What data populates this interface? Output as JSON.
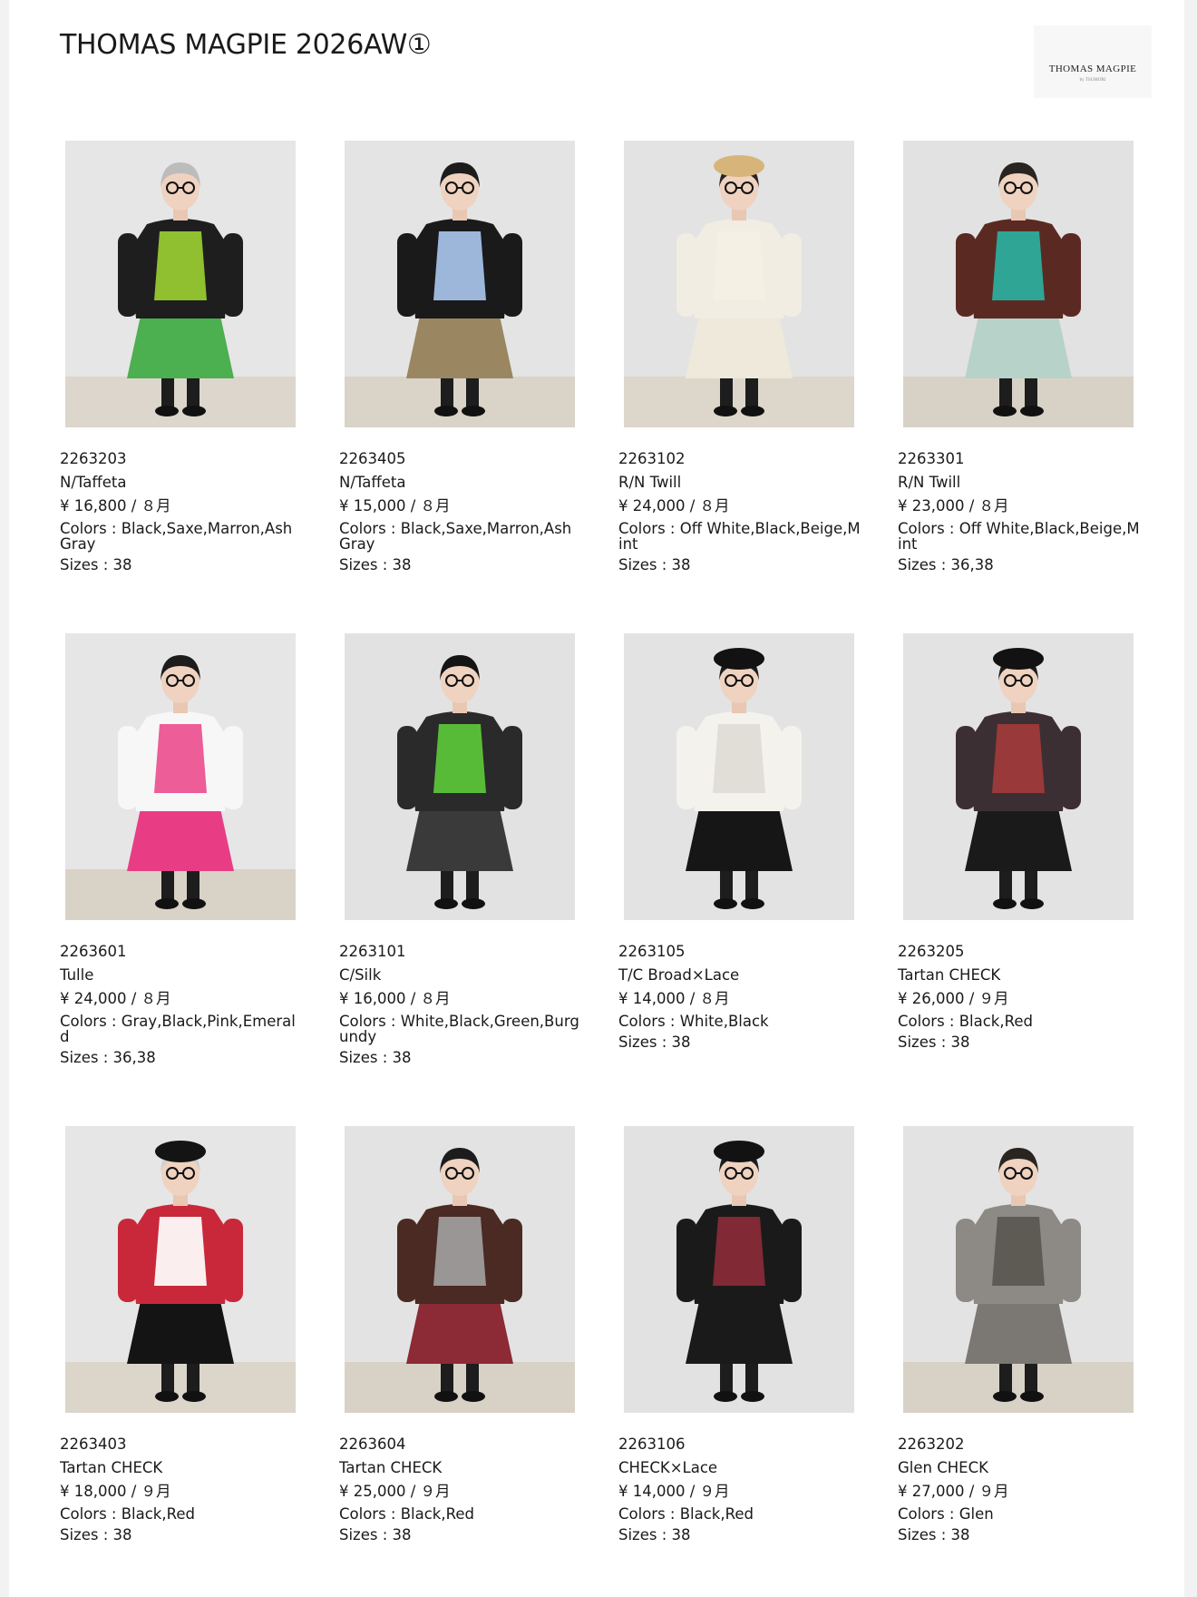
{
  "page": {
    "title": "THOMAS MAGPIE 2026AW①",
    "logo_text": "THOMAS MAGPIE",
    "logo_sub": "by\nTSUMORI"
  },
  "products": [
    {
      "code": "2263203",
      "fabric": "N/Taffeta",
      "price": "¥ 16,800 / ８月",
      "colors": "Colors : Black,Saxe,Marron,Ash Gray",
      "sizes": "Sizes : 38"
    },
    {
      "code": "2263405",
      "fabric": "N/Taffeta",
      "price": "¥ 15,000 / ８月",
      "colors": "Colors : Black,Saxe,Marron,Ash Gray",
      "sizes": "Sizes : 38"
    },
    {
      "code": "2263102",
      "fabric": "R/N Twill",
      "price": "¥ 24,000 / ８月",
      "colors": "Colors : Off White,Black,Beige,Mint",
      "sizes": "Sizes : 38"
    },
    {
      "code": "2263301",
      "fabric": "R/N Twill",
      "price": "¥ 23,000 / ８月",
      "colors": "Colors : Off White,Black,Beige,Mint",
      "sizes": "Sizes : 36,38"
    },
    {
      "code": "2263601",
      "fabric": "Tulle",
      "price": "¥ 24,000 / ８月",
      "colors": "Colors : Gray,Black,Pink,Emerald",
      "sizes": "Sizes : 36,38"
    },
    {
      "code": "2263101",
      "fabric": "C/Silk",
      "price": "¥ 16,000 / ８月",
      "colors": "Colors : White,Black,Green,Burgundy",
      "sizes": "Sizes : 38"
    },
    {
      "code": "2263105",
      "fabric": "T/C Broad×Lace",
      "price": "¥ 14,000 / ８月",
      "colors": "Colors : White,Black",
      "sizes": "Sizes : 38"
    },
    {
      "code": "2263205",
      "fabric": "Tartan CHECK",
      "price": "¥ 26,000 / ９月",
      "colors": "Colors : Black,Red",
      "sizes": "Sizes : 38"
    },
    {
      "code": "2263403",
      "fabric": "Tartan CHECK",
      "price": "¥ 18,000 / ９月",
      "colors": "Colors : Black,Red",
      "sizes": "Sizes : 38"
    },
    {
      "code": "2263604",
      "fabric": "Tartan CHECK",
      "price": "¥ 25,000 / ９月",
      "colors": "Colors : Black,Red",
      "sizes": "Sizes : 38"
    },
    {
      "code": "2263106",
      "fabric": "CHECK×Lace",
      "price": "¥ 14,000 / ９月",
      "colors": "Colors : Black,Red",
      "sizes": "Sizes : 38"
    },
    {
      "code": "2263202",
      "fabric": "Glen CHECK",
      "price": "¥ 27,000 / ９月",
      "colors": "Colors : Glen",
      "sizes": "Sizes : 38"
    }
  ],
  "photos": [
    {
      "wall": "#e6e6e6",
      "floor": "#dcd6cc",
      "top": "#1e1e1e",
      "accent": "#9acd32",
      "bottom": "#4caf50",
      "hair": "#bcbcbc",
      "hat": ""
    },
    {
      "wall": "#e4e4e4",
      "floor": "#d9d3c8",
      "top": "#1a1a1a",
      "accent": "#a8c4ec",
      "bottom": "#9a8660",
      "hair": "#1c1c1c",
      "hat": ""
    },
    {
      "wall": "#e3e3e3",
      "floor": "#ddd6cb",
      "top": "#f1ede2",
      "accent": "#f4f0e4",
      "bottom": "#efe9dc",
      "hair": "#2a2420",
      "hat": "#d7b57a"
    },
    {
      "wall": "#e2e2e2",
      "floor": "#d8d2c6",
      "top": "#5a2a22",
      "accent": "#2ab0a0",
      "bottom": "#b7d2c8",
      "hair": "#2a2420",
      "hat": ""
    },
    {
      "wall": "#e6e6e6",
      "floor": "#d9d2c6",
      "top": "#f7f7f7",
      "accent": "#ec4f8e",
      "bottom": "#e83d84",
      "hair": "#1c1c1c",
      "hat": ""
    },
    {
      "wall": "#e2e2e2",
      "floor": "#e2e2e2",
      "top": "#2a2a2a",
      "accent": "#5cc83a",
      "bottom": "#3a3a3a",
      "hair": "#141414",
      "hat": ""
    },
    {
      "wall": "#e3e3e3",
      "floor": "#e3e3e3",
      "top": "#f4f2ec",
      "accent": "#dedcd6",
      "bottom": "#161616",
      "hair": "#1c1c1c",
      "hat": "#121212"
    },
    {
      "wall": "#e3e3e3",
      "floor": "#e3e3e3",
      "top": "#3c2f33",
      "accent": "#a33b3b",
      "bottom": "#1a1a1a",
      "hair": "#1c1c1c",
      "hat": "#121212"
    },
    {
      "wall": "#e6e6e6",
      "floor": "#dbd5ca",
      "top": "#c9283a",
      "accent": "#ffffff",
      "bottom": "#141414",
      "hair": "#d0d0d0",
      "hat": "#141414"
    },
    {
      "wall": "#e3e3e3",
      "floor": "#d8d2c6",
      "top": "#4a2a22",
      "accent": "#a0a0a0",
      "bottom": "#8c2a36",
      "hair": "#1c1c1c",
      "hat": ""
    },
    {
      "wall": "#e2e2e2",
      "floor": "#e2e2e2",
      "top": "#1a1a1a",
      "accent": "#8a2a36",
      "bottom": "#1a1a1a",
      "hair": "#1c1c1c",
      "hat": "#121212"
    },
    {
      "wall": "#e3e3e3",
      "floor": "#d8d2c6",
      "top": "#8d8a86",
      "accent": "#5a5650",
      "bottom": "#7b7772",
      "hair": "#2a2420",
      "hat": ""
    }
  ]
}
